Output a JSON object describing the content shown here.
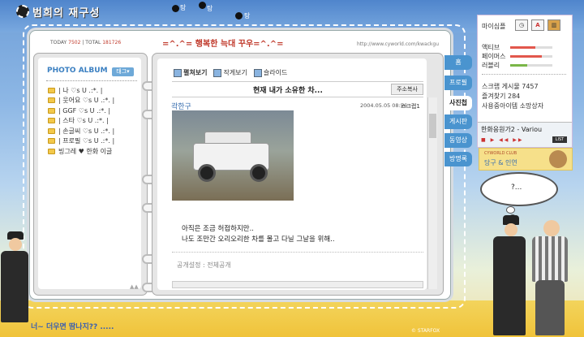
{
  "title": "범희의 재구성",
  "top_dots": [
    "탕",
    "탕",
    "탕"
  ],
  "counter": {
    "today_label": "TODAY",
    "today_value": "7502",
    "sep": " | ",
    "total_label": "TOTAL",
    "total_value": "181726"
  },
  "headline": "=^.^= 행복한 늑대 꾸우=^.^=",
  "url": "http://www.cyworld.com/kwackgu",
  "photo_album": {
    "title": "PHOTO ALBUM",
    "tag_button": "태그▾",
    "folders": [
      "| 나 ♡s U .:*. |",
      "| 웃어요 ♡s U .:*. |",
      "| GGF ♡s U .:*. |",
      "| 스타 ♡s U .:*. |",
      "| 손글씨 ♡s U .:*. |",
      "| 프로필 ♡s U .:*. |",
      "빙그레 ♥ 한화 이글"
    ]
  },
  "post": {
    "view_options": [
      "펼쳐보기",
      "작게보기",
      "슬라이드"
    ],
    "title": "현재 내가 소유한 차...",
    "copy_address": "주소복사",
    "author": "곽한구",
    "date": "2004.05.05 08:56",
    "scrap": "스크랩1",
    "text_line1": "아직은 조금 허접하지만..",
    "text_line2": "나도 조만간 오리오리한 차를 몰고 다닐 그날을 위해..",
    "privacy": "공개설정 : 전체공개"
  },
  "tabs": [
    "홈",
    "프로필",
    "사진첩",
    "게시판",
    "동영상",
    "방명록"
  ],
  "active_tab": "사진첩",
  "sidebar": {
    "my_mood": "마이심플",
    "stats": [
      {
        "label": "액티브",
        "value": 0.6,
        "color": "#e2574c"
      },
      {
        "label": "페이머스",
        "value": 0.75,
        "color": "#e2574c"
      },
      {
        "label": "러블리",
        "value": 0.4,
        "color": "#7ab648"
      }
    ],
    "scrap_board": "스크랩 게시물 7457",
    "favorites": "즐겨찾기 284",
    "shopping": "사용중아이템 소망상자",
    "player_title": "한화응원가2 - Variou",
    "list_button": "LIST"
  },
  "club": {
    "small": "CYWORLD CLUB",
    "name": "당구 & 인연"
  },
  "bubble": "?...",
  "bottom_text": "너~ 더우면 땀나지?? .....",
  "credit": "© STARFOX"
}
